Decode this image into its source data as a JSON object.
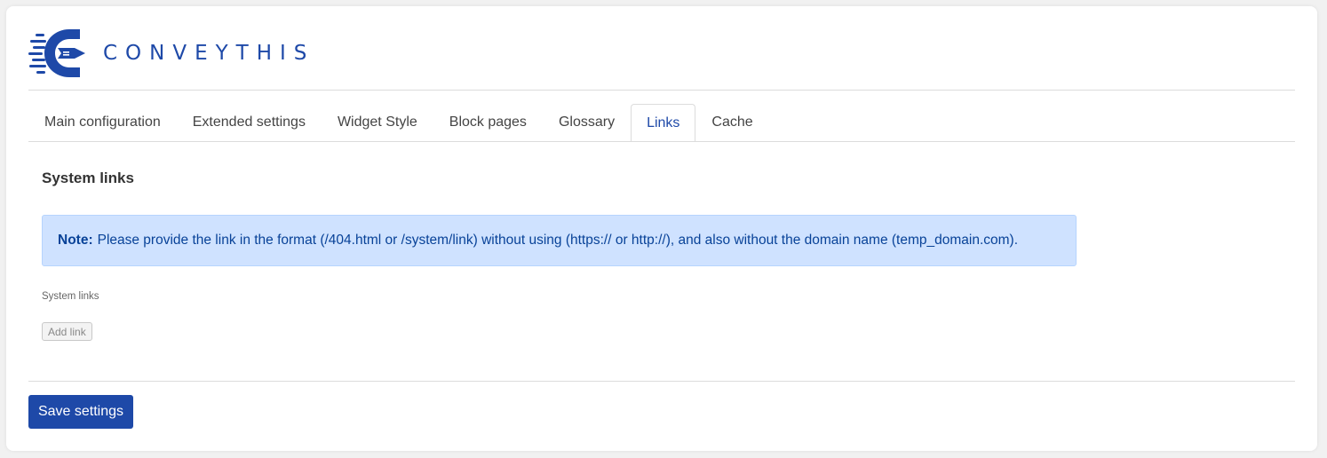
{
  "brand": {
    "name": "CONVEYTHIS",
    "color": "#1e49a8"
  },
  "tabs": [
    {
      "label": "Main configuration",
      "active": false
    },
    {
      "label": "Extended settings",
      "active": false
    },
    {
      "label": "Widget Style",
      "active": false
    },
    {
      "label": "Block pages",
      "active": false
    },
    {
      "label": "Glossary",
      "active": false
    },
    {
      "label": "Links",
      "active": true
    },
    {
      "label": "Cache",
      "active": false
    }
  ],
  "section": {
    "title": "System links",
    "note_label": "Note:",
    "note_text": "Please provide the link in the format (/404.html or /system/link) without using (https:// or http://), and also without the domain name (temp_domain.com).",
    "field_label": "System links",
    "add_button": "Add link"
  },
  "footer": {
    "save_label": "Save settings"
  },
  "colors": {
    "accent": "#1e49a8",
    "note_bg": "#cfe2ff",
    "note_text": "#084298"
  }
}
